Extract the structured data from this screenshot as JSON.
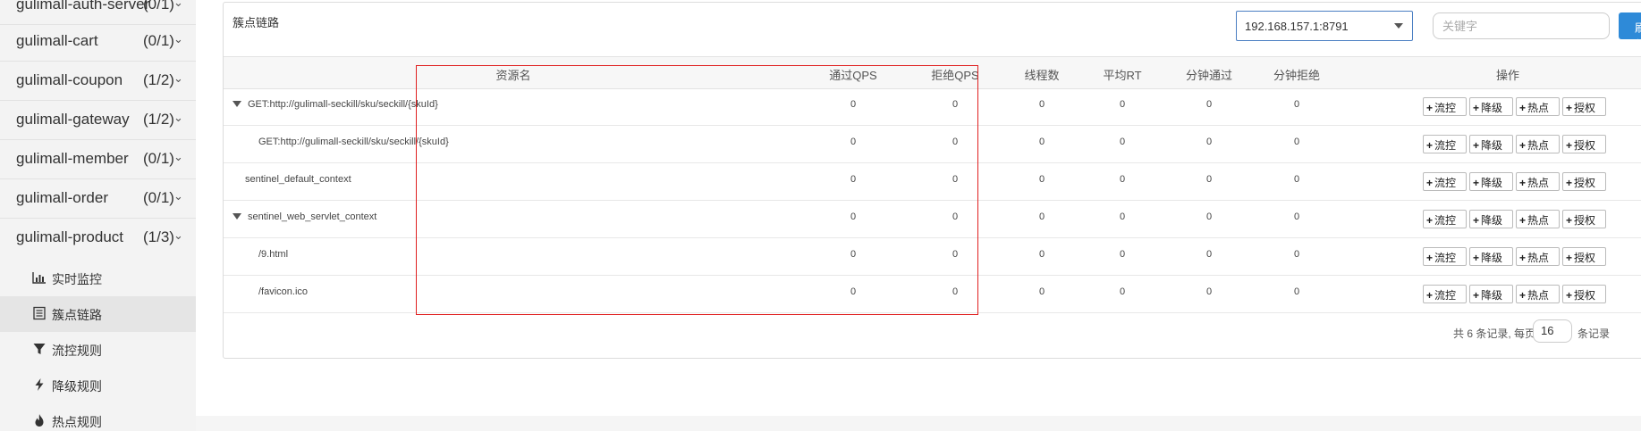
{
  "sidebar": {
    "apps": [
      {
        "name": "gulimall-auth-server",
        "count": "(0/1)"
      },
      {
        "name": "gulimall-cart",
        "count": "(0/1)"
      },
      {
        "name": "gulimall-coupon",
        "count": "(1/2)"
      },
      {
        "name": "gulimall-gateway",
        "count": "(1/2)"
      },
      {
        "name": "gulimall-member",
        "count": "(0/1)"
      },
      {
        "name": "gulimall-order",
        "count": "(0/1)"
      },
      {
        "name": "gulimall-product",
        "count": "(1/3)"
      }
    ],
    "chevron": "⌄",
    "sub_items": [
      {
        "label": "实时监控",
        "icon": "bar-chart-icon"
      },
      {
        "label": "簇点链路",
        "icon": "list-icon"
      },
      {
        "label": "流控规则",
        "icon": "filter-icon"
      },
      {
        "label": "降级规则",
        "icon": "lightning-icon"
      },
      {
        "label": "热点规则",
        "icon": "fire-icon"
      }
    ],
    "active_sub_item": "簇点链路"
  },
  "panel": {
    "title": "簇点链路",
    "machine_select": "192.168.157.1:8791",
    "keyword_placeholder": "关键字",
    "refresh_label": "刷新"
  },
  "table": {
    "headers": [
      "资源名",
      "通过QPS",
      "拒绝QPS",
      "线程数",
      "平均RT",
      "分钟通过",
      "分钟拒绝",
      "操作"
    ],
    "rows": [
      {
        "name": "GET:http://gulimall-seckill/sku/seckill/{skuId}",
        "expandable": true,
        "level": 0,
        "values": [
          "0",
          "0",
          "0",
          "0",
          "0",
          "0"
        ]
      },
      {
        "name": "GET:http://gulimall-seckill/sku/seckill/{skuId}",
        "expandable": false,
        "level": 1,
        "values": [
          "0",
          "0",
          "0",
          "0",
          "0",
          "0"
        ]
      },
      {
        "name": "sentinel_default_context",
        "expandable": false,
        "level": 0,
        "values": [
          "0",
          "0",
          "0",
          "0",
          "0",
          "0"
        ]
      },
      {
        "name": "sentinel_web_servlet_context",
        "expandable": true,
        "level": 0,
        "values": [
          "0",
          "0",
          "0",
          "0",
          "0",
          "0"
        ]
      },
      {
        "name": "/9.html",
        "expandable": false,
        "level": 1,
        "values": [
          "0",
          "0",
          "0",
          "0",
          "0",
          "0"
        ]
      },
      {
        "name": "/favicon.ico",
        "expandable": false,
        "level": 1,
        "values": [
          "0",
          "0",
          "0",
          "0",
          "0",
          "0"
        ]
      }
    ],
    "actions": [
      "流控",
      "降级",
      "热点",
      "授权"
    ],
    "action_prefix": "+"
  },
  "pagination": {
    "prefix": "共 6 条记录, 每页",
    "page_size": "16",
    "suffix": "条记录"
  },
  "colors": {
    "accent": "#2e8ad8",
    "highlight": "#e02020"
  }
}
